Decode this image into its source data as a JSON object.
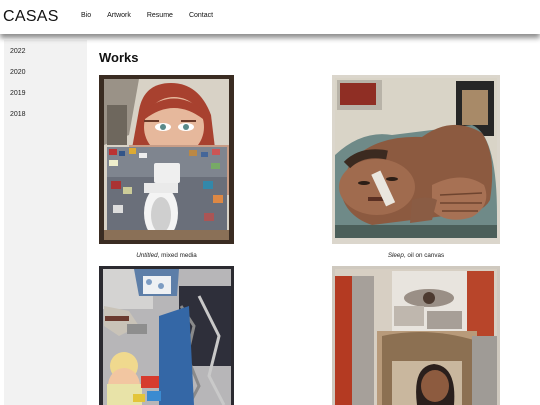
{
  "header": {
    "brand": "CASAS",
    "nav": [
      "Bio",
      "Artwork",
      "Resume",
      "Contact"
    ]
  },
  "sidebar": {
    "years": [
      "2022",
      "2020",
      "2019",
      "2018"
    ]
  },
  "main": {
    "title": "Works",
    "works": [
      {
        "title": "Untitled",
        "medium": ", mixed media"
      },
      {
        "title": "Sleep",
        "medium": ", oil on canvas"
      },
      {
        "title": "",
        "medium": ""
      },
      {
        "title": "",
        "medium": ""
      }
    ]
  }
}
